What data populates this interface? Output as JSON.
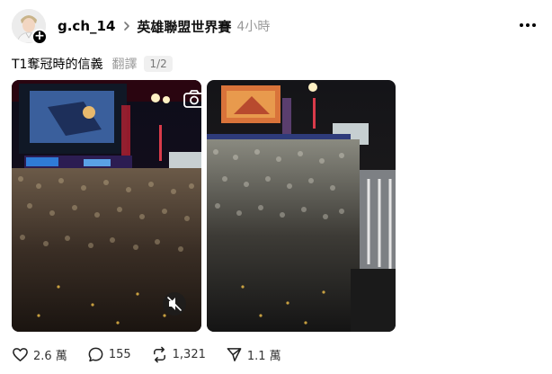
{
  "post": {
    "username": "g.ch_14",
    "topic": "英雄聯盟世界賽",
    "time": "4小時",
    "text": "T1奪冠時的信義",
    "translate_label": "翻譯",
    "page_indicator": "1/2"
  },
  "actions": {
    "likes": "2.6 萬",
    "comments": "155",
    "reposts": "1,321",
    "shares": "1.1 萬"
  },
  "icons": {
    "avatar": "user-avatar",
    "follow": "plus-icon",
    "topic_separator": "chevron-right-icon",
    "more": "more-options-icon",
    "camera": "camera-icon",
    "mute": "muted-speaker-icon",
    "like": "heart-icon",
    "comment": "comment-icon",
    "repost": "repost-icon",
    "share": "send-icon"
  },
  "colors": {
    "text": "#000000",
    "muted": "#999999",
    "background": "#ffffff"
  }
}
